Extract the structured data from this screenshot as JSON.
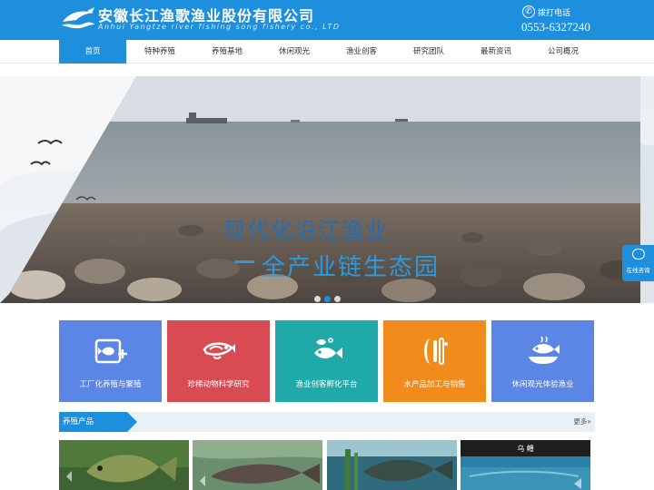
{
  "header": {
    "company_cn": "安徽长江渔歌渔业股份有限公司",
    "company_en": "Anhui Yangtze river fishing song  fishery  co., LTD",
    "phone_label": "拨打电话",
    "phone_number": "0553-6327240",
    "logo_icon": "fish-wave-logo-icon"
  },
  "nav": {
    "items": [
      "首页",
      "特种养殖",
      "养殖基地",
      "休闲观光",
      "渔业创客",
      "研究团队",
      "最新资讯",
      "公司概况"
    ],
    "active_index": 0
  },
  "banner": {
    "line1": "现代化沿江渔业",
    "line2": "全产业链生态园",
    "slides": 3,
    "active_slide": 1
  },
  "consult": {
    "label": "在线咨询",
    "icon": "chat-bubble-icon"
  },
  "services": [
    {
      "label": "工厂化养殖与繁殖",
      "color": "#5b86e5",
      "icon": "fish-tank-icon"
    },
    {
      "label": "珍稀动物科学研究",
      "color": "#d94b52",
      "icon": "rare-fish-icon"
    },
    {
      "label": "渔业创客孵化平台",
      "color": "#1fa9a9",
      "icon": "fish-school-icon"
    },
    {
      "label": "水产品加工与销售",
      "color": "#f08b1c",
      "icon": "processing-icon"
    },
    {
      "label": "休闲观光体验渔业",
      "color": "#5b86e5",
      "icon": "fish-dish-icon"
    }
  ],
  "products": {
    "title": "养殖产品",
    "more": "更多»",
    "items": [
      {
        "caption": ""
      },
      {
        "caption": ""
      },
      {
        "caption": ""
      },
      {
        "caption": "乌  鳢"
      }
    ]
  },
  "colors": {
    "brand_blue": "#1d8fdd"
  }
}
